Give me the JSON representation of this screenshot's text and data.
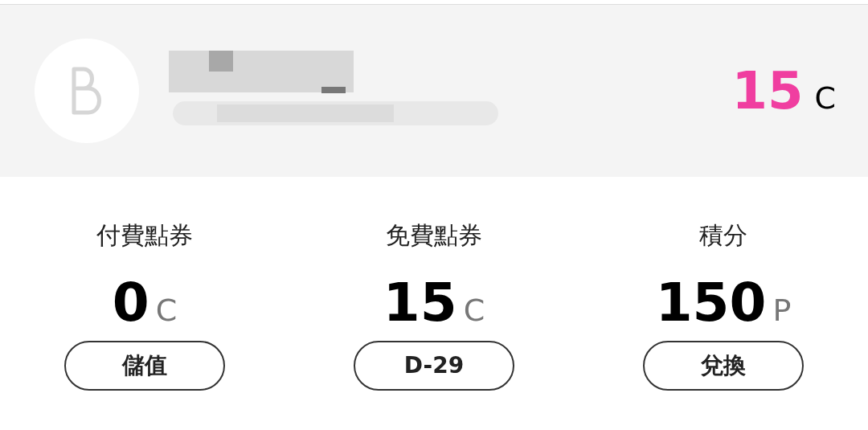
{
  "header": {
    "balance": {
      "value": "15",
      "unit": "C"
    }
  },
  "wallets": [
    {
      "label": "付費點券",
      "value": "0",
      "unit": "C",
      "button": "儲值"
    },
    {
      "label": "免費點券",
      "value": "15",
      "unit": "C",
      "button": "D-29"
    },
    {
      "label": "積分",
      "value": "150",
      "unit": "P",
      "button": "兌換"
    }
  ]
}
